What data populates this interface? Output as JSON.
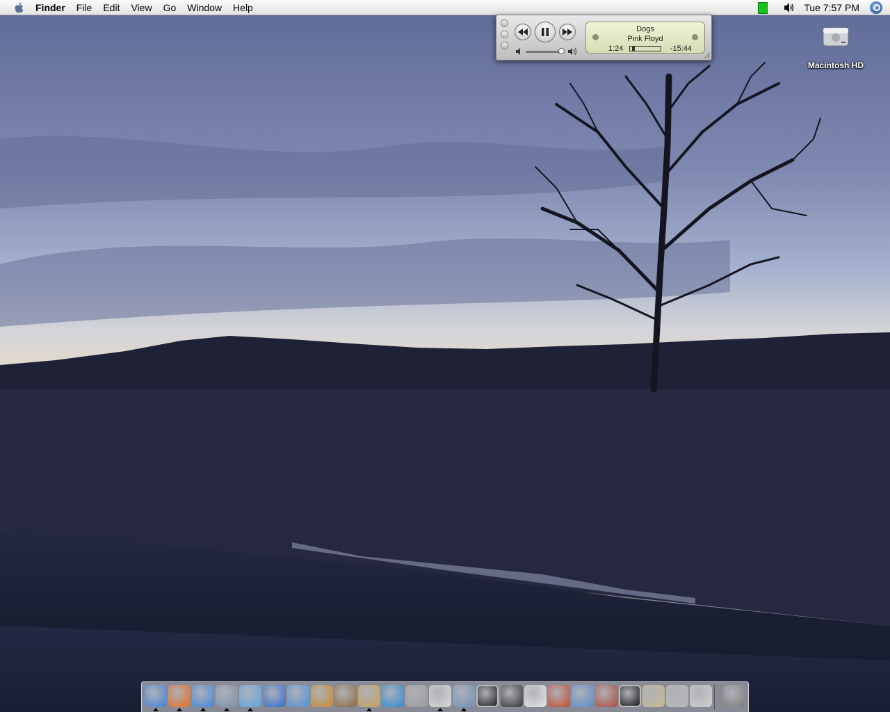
{
  "menubar": {
    "apple_icon": "apple-icon",
    "items": [
      "Finder",
      "File",
      "Edit",
      "View",
      "Go",
      "Window",
      "Help"
    ],
    "battery_color": "#19c21f",
    "clock": "Tue 7:57 PM",
    "volume_icon": "speaker-icon",
    "spotlight_icon": "spotlight-icon"
  },
  "mini_player": {
    "song": "Dogs",
    "artist": "Pink Floyd",
    "elapsed": "1:24",
    "remaining": "-15:44",
    "progress_fraction": 0.08,
    "volume_fraction": 0.9,
    "buttons": [
      "previous-icon",
      "pause-icon",
      "next-icon"
    ]
  },
  "desktop": {
    "icons": [
      {
        "label": "Macintosh HD",
        "icon": "hard-drive-icon"
      }
    ]
  },
  "dock": {
    "items": [
      {
        "name": "finder",
        "color": "#3f7fd6",
        "running": true
      },
      {
        "name": "firefox",
        "color": "#e86a1a",
        "running": true
      },
      {
        "name": "ichat",
        "color": "#3a86e0",
        "running": true
      },
      {
        "name": "mail",
        "color": "#7a8fa8",
        "running": true
      },
      {
        "name": "itunes",
        "color": "#5aa6e6",
        "running": true
      },
      {
        "name": "imovie",
        "color": "#2d6bd0",
        "running": false
      },
      {
        "name": "idvd",
        "color": "#4d8fd8",
        "running": false
      },
      {
        "name": "garageband",
        "color": "#c98a2c",
        "running": false
      },
      {
        "name": "iphoto",
        "color": "#8c6a3a",
        "running": false
      },
      {
        "name": "address-book",
        "color": "#c8a05a",
        "running": true
      },
      {
        "name": "quicktime",
        "color": "#2a8ad6",
        "running": false
      },
      {
        "name": "automator",
        "color": "#9a9a9a",
        "running": false
      },
      {
        "name": "textedit",
        "color": "#d8d8d8",
        "running": true
      },
      {
        "name": "preview",
        "color": "#6f8fb8",
        "running": true
      },
      {
        "name": "terminal",
        "color": "#222222",
        "running": false
      },
      {
        "name": "clapper",
        "color": "#333333",
        "running": false
      },
      {
        "name": "youtube",
        "color": "#e6e6e6",
        "running": false
      },
      {
        "name": "handbrake",
        "color": "#c44828",
        "running": false
      },
      {
        "name": "system-profiler",
        "color": "#5a8ac8",
        "running": false
      },
      {
        "name": "disk-utility",
        "color": "#aa4a3a",
        "running": false
      },
      {
        "name": "activity-monitor",
        "color": "#1a1a1a",
        "running": false
      },
      {
        "name": "installer",
        "color": "#c8b890",
        "running": false
      },
      {
        "name": "system-preferences",
        "color": "#b8b8b8",
        "running": false
      },
      {
        "name": "utility",
        "color": "#d0d0d0",
        "running": false
      },
      {
        "name": "trash",
        "color": "#7a7a7a",
        "running": false
      }
    ]
  }
}
